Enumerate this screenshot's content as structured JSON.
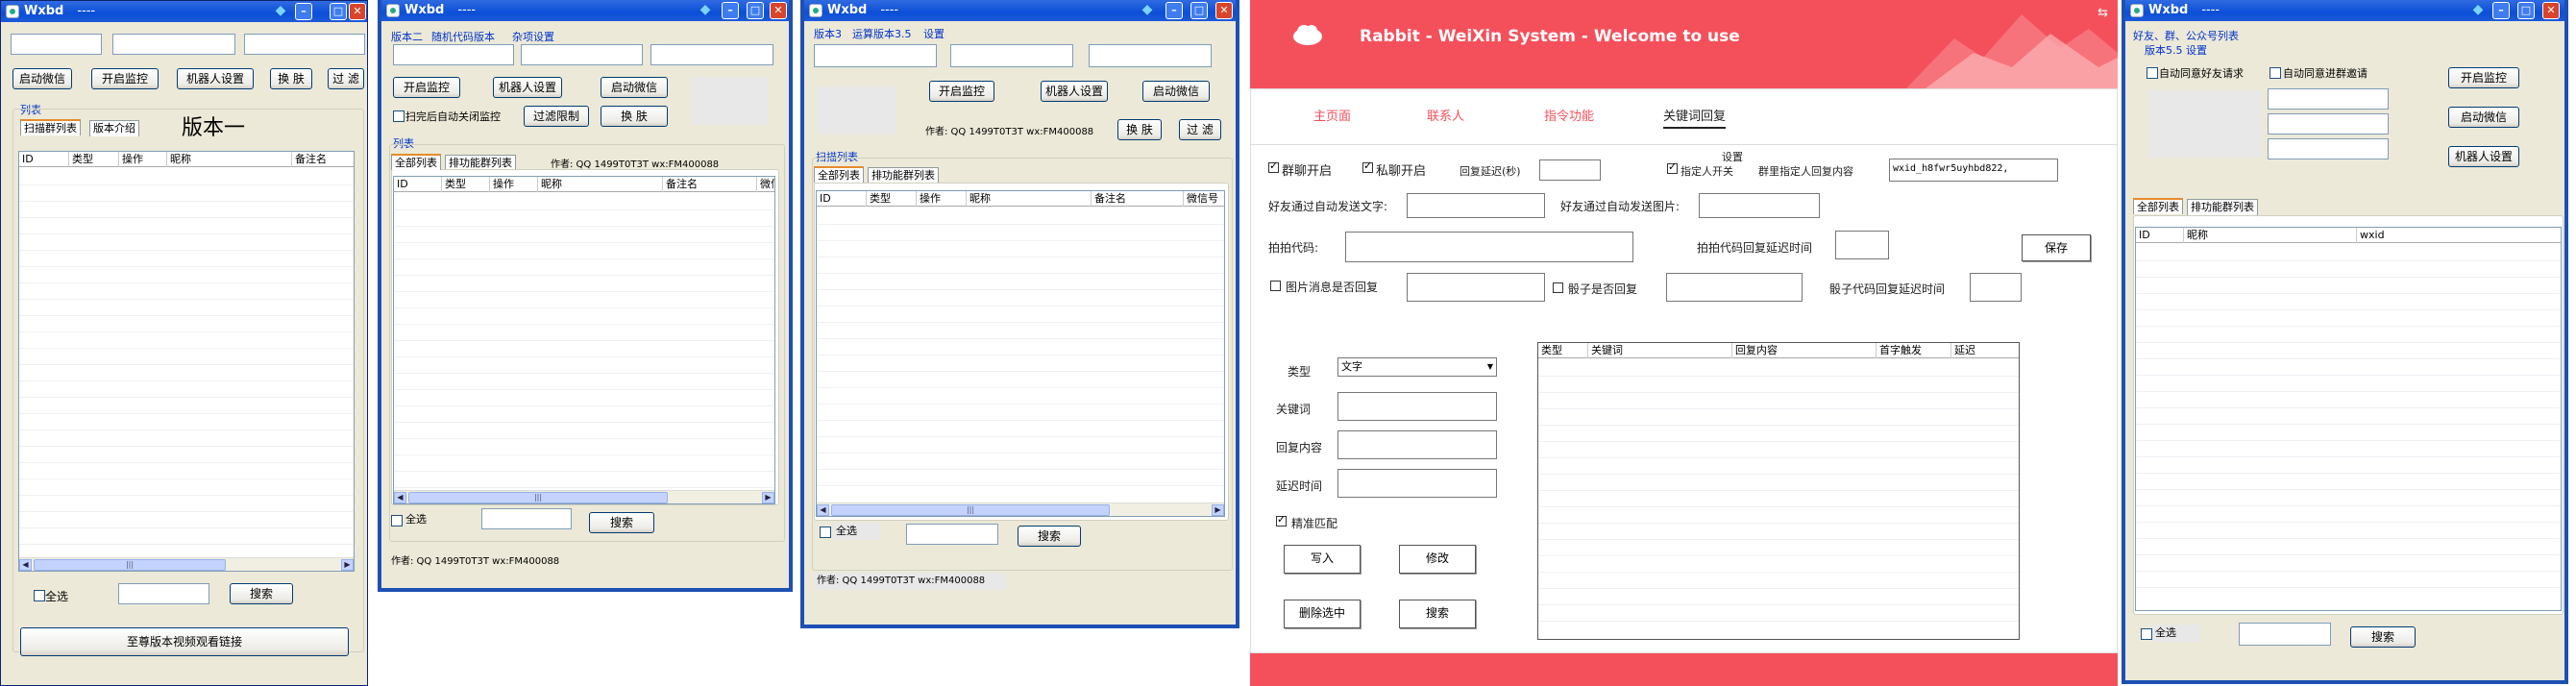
{
  "w1": {
    "title": "Wxbd",
    "subtitle": "----",
    "btn_start": "启动微信",
    "btn_monitor": "开启监控",
    "btn_robot": "机器人设置",
    "btn_skin": "换 肤",
    "btn_filter": "过 滤",
    "group_list": "列表",
    "tab_group": "扫描群列表",
    "tab_intro": "版本介绍",
    "version": "版本一",
    "cols": [
      "ID",
      "类型",
      "操作",
      "昵称",
      "备注名"
    ],
    "select_all": "全选",
    "btn_search": "搜索",
    "btn_video": "至尊版本视频观看链接"
  },
  "w2": {
    "title": "Wxbd",
    "subtitle": "----",
    "tab_v2": "版本二",
    "tab_random": "随机代码版本",
    "tab_misc": "杂项设置",
    "btn_monitor": "开启监控",
    "btn_robot": "机器人设置",
    "btn_start": "启动微信",
    "chk_autoclose": "扫完后自动关闭监控",
    "btn_filter_limit": "过滤限制",
    "btn_skin": "换 肤",
    "group_list": "列表",
    "tab_all": "全部列表",
    "tab_group": "排功能群列表",
    "author_inline": "作者: QQ 1499T0T3T  wx:FM400088",
    "cols": [
      "ID",
      "类型",
      "操作",
      "昵称",
      "备注名",
      "微信号"
    ],
    "select_all": "全选",
    "btn_search": "搜索",
    "author": "作者: QQ 1499T0T3T  wx:FM400088"
  },
  "w3": {
    "title": "Wxbd",
    "subtitle": "----",
    "tab_v3": "版本3",
    "tab_algo": "运算版本3.5",
    "tab_settings": "设置",
    "btn_monitor": "开启监控",
    "btn_robot": "机器人设置",
    "btn_start": "启动微信",
    "author_inline": "作者: QQ 1499T0T3T  wx:FM400088",
    "btn_skin": "换 肤",
    "btn_filter": "过 滤",
    "group_list": "扫描列表",
    "tab_all": "全部列表",
    "tab_group": "排功能群列表",
    "cols": [
      "ID",
      "类型",
      "操作",
      "昵称",
      "备注名",
      "微信号"
    ],
    "select_all": "全选",
    "btn_search": "搜索",
    "author": "作者: QQ 1499T0T3T  wx:FM400088"
  },
  "rabbit": {
    "title": "Rabbit - WeiXin System - Welcome to use",
    "corner_glyph": "⇆",
    "nav": [
      "主页面",
      "联系人",
      "指令功能",
      "关键词回复"
    ],
    "settings_label": "设置",
    "chk_group": "群聊开启",
    "chk_private": "私聊开启",
    "reply_delay_label": "回复延迟(秒)",
    "chk_assign": "指定人开关",
    "assign_label": "群里指定人回复内容",
    "assign_value": "wxid_h8fwr5uyhbd822,",
    "friend_text_label": "好友通过自动发送文字:",
    "friend_img_label": "好友通过自动发送图片:",
    "pat_code_label": "拍拍代码:",
    "pat_delay_label": "拍拍代码回复延迟时间",
    "btn_save": "保存",
    "chk_img_reply": "图片消息是否回复",
    "chk_dice": "骰子是否回复",
    "dice_delay_label": "骰子代码回复延迟时间",
    "type_label": "类型",
    "type_value": "文字",
    "keyword_label": "关键词",
    "reply_label": "回复内容",
    "delay_label": "延迟时间",
    "chk_exact": "精准匹配",
    "btn_write": "写入",
    "btn_modify": "修改",
    "btn_delete": "删除选中",
    "btn_search": "搜索",
    "cols": [
      "类型",
      "关键词",
      "回复内容",
      "首字触发",
      "延迟"
    ]
  },
  "w5": {
    "title": "Wxbd",
    "subtitle": "----",
    "menu_link": "好友、群、公众号列表",
    "tab_v55": "版本5.5 设置",
    "chk_friend": "自动同意好友请求",
    "chk_group": "自动同意进群邀请",
    "btn_monitor": "开启监控",
    "btn_start": "启动微信",
    "btn_robot": "机器人设置",
    "tab_all": "全部列表",
    "tab_group": "排功能群列表",
    "cols": [
      "ID",
      "昵称",
      "wxid"
    ],
    "select_all": "全选",
    "btn_search": "搜索"
  },
  "icons": {
    "globe": "◆",
    "min": "–",
    "max": "□",
    "close": "✕",
    "scroll_left": "◀",
    "scroll_right": "▶",
    "grip": "|||",
    "dropdown": "▼"
  }
}
